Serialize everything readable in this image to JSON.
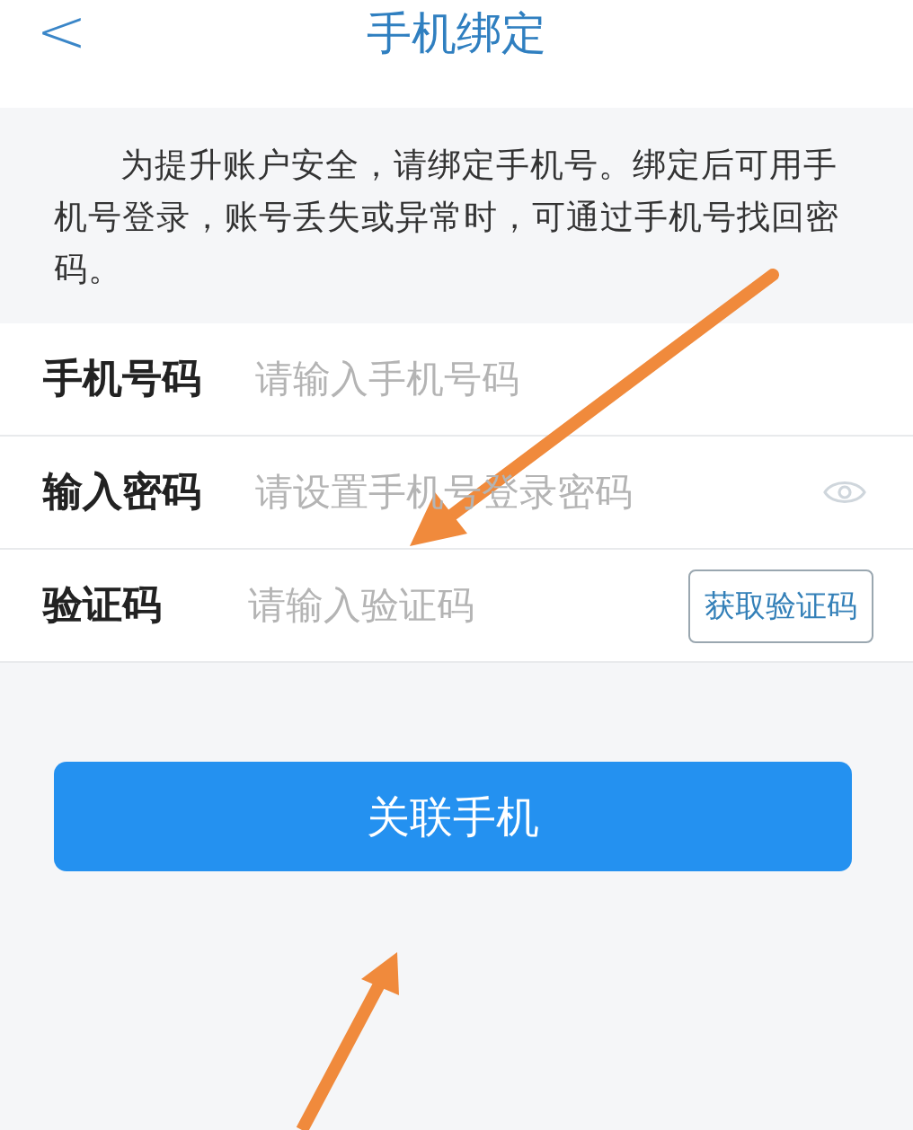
{
  "header": {
    "back": "<",
    "title": "手机绑定"
  },
  "notice": "为提升账户安全，请绑定手机号。绑定后可用手机号登录，账号丢失或异常时，可通过手机号找回密码。",
  "fields": [
    {
      "kind": "phone",
      "label": "手机号码",
      "placeholder": "请输入手机号码"
    },
    {
      "kind": "password",
      "label": "输入密码",
      "placeholder": "请设置手机号登录密码"
    },
    {
      "kind": "code",
      "label": "验证码",
      "placeholder": "请输入验证码",
      "action": "获取验证码"
    }
  ],
  "submit": "关联手机"
}
